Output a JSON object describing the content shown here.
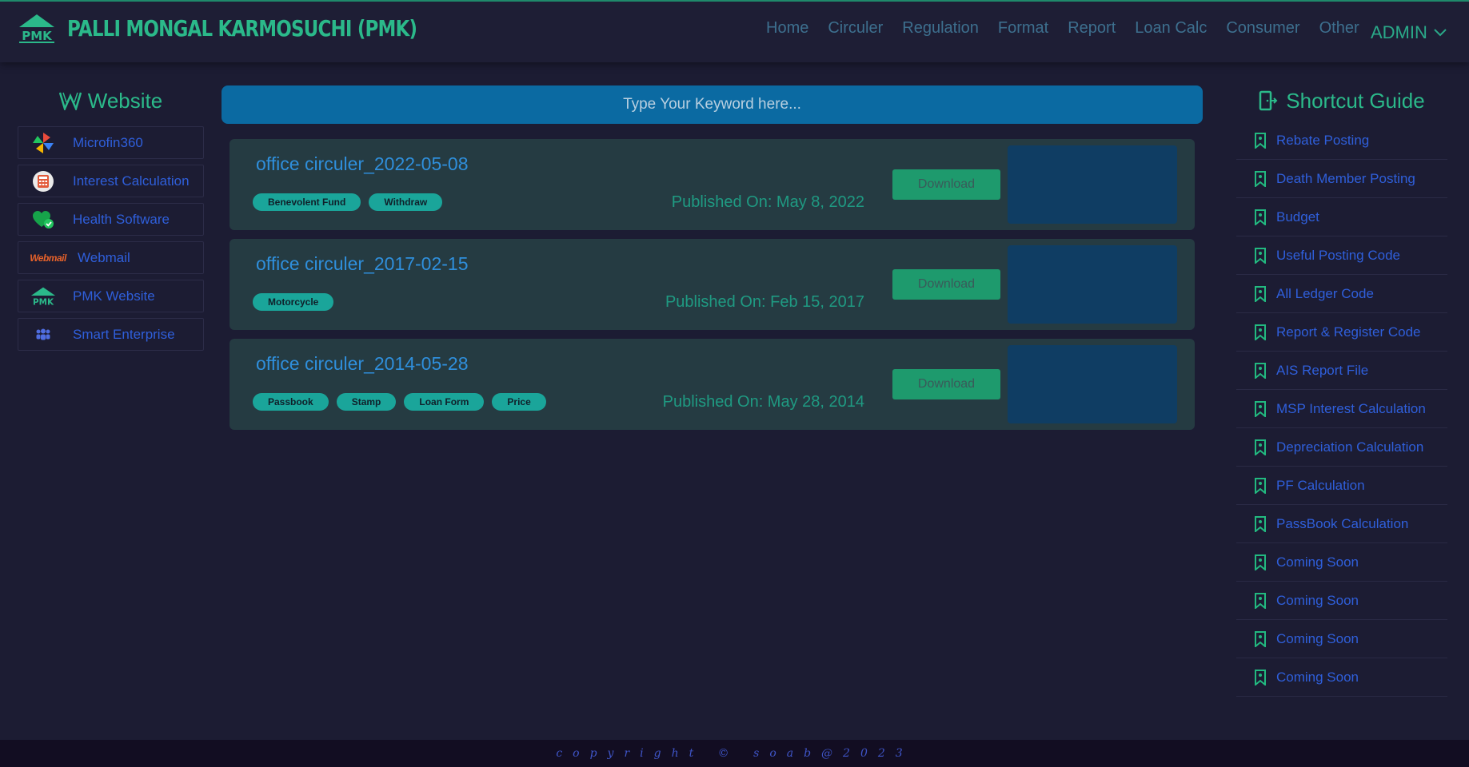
{
  "header": {
    "logo_text": "PMK",
    "title": "PALLI MONGAL KARMOSUCHI (PMK)",
    "nav": [
      "Home",
      "Circuler",
      "Regulation",
      "Format",
      "Report",
      "Loan Calc",
      "Consumer",
      "Other"
    ],
    "user": "ADMIN"
  },
  "left_sidebar": {
    "heading": "Website",
    "items": [
      {
        "label": "Microfin360",
        "icon": "pinwheel-icon"
      },
      {
        "label": "Interest Calculation",
        "icon": "calculator-icon"
      },
      {
        "label": "Health Software",
        "icon": "heart-check-icon"
      },
      {
        "label": "Webmail",
        "icon": "webmail-logo",
        "icon_text": "Webmail"
      },
      {
        "label": "PMK Website",
        "icon": "pmk-logo-icon",
        "icon_text": "PMK"
      },
      {
        "label": "Smart Enterprise",
        "icon": "people-icon"
      }
    ]
  },
  "search": {
    "placeholder": "Type Your Keyword here..."
  },
  "circulars": [
    {
      "title": "office circuler_2022-05-08",
      "tags": [
        "Benevolent Fund",
        "Withdraw"
      ],
      "published": "Published On: May 8, 2022",
      "button": "Download"
    },
    {
      "title": "office circuler_2017-02-15",
      "tags": [
        "Motorcycle"
      ],
      "published": "Published On: Feb 15, 2017",
      "button": "Download"
    },
    {
      "title": "office circuler_2014-05-28",
      "tags": [
        "Passbook",
        "Stamp",
        "Loan Form",
        "Price"
      ],
      "published": "Published On: May 28, 2014",
      "button": "Download"
    }
  ],
  "right_sidebar": {
    "heading": "Shortcut Guide",
    "items": [
      "Rebate Posting",
      "Death Member Posting",
      "Budget",
      "Useful Posting Code",
      "All Ledger Code",
      "Report & Register Code",
      "AIS Report File",
      "MSP Interest Calculation",
      "Depreciation Calculation",
      "PF Calculation",
      "PassBook Calculation",
      "Coming Soon",
      "Coming Soon",
      "Coming Soon",
      "Coming Soon"
    ]
  },
  "footer": {
    "text": "copyright © soab@2023"
  },
  "colors": {
    "background": "#1c1c33",
    "accent_green": "#2bb98a",
    "link_blue": "#2f5fdb",
    "search_bar": "#0b6aa2",
    "card": "#253b42",
    "tag": "#1aa59a",
    "download_button": "#1e9a6d",
    "thumbnail": "#0f3d63"
  }
}
